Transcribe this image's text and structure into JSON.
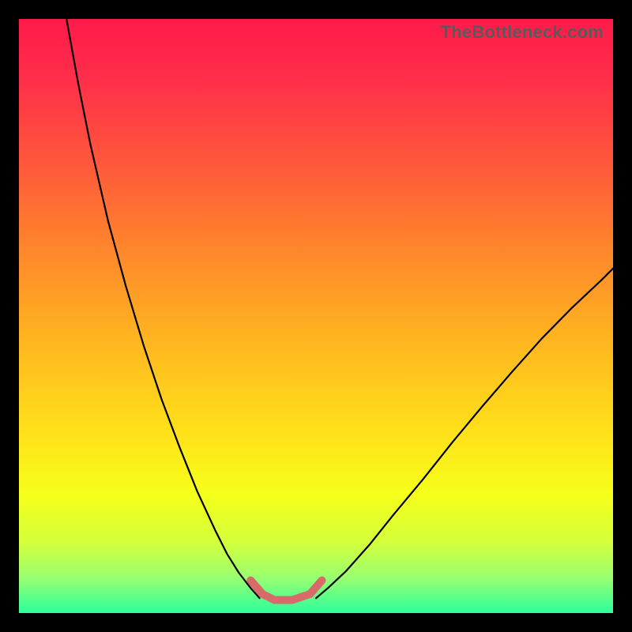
{
  "watermark": "TheBottleneck.com",
  "gradient_stops": [
    {
      "offset": 0.0,
      "color": "#ff1a4a"
    },
    {
      "offset": 0.1,
      "color": "#ff2e4a"
    },
    {
      "offset": 0.25,
      "color": "#ff5a3a"
    },
    {
      "offset": 0.4,
      "color": "#ff8a2a"
    },
    {
      "offset": 0.55,
      "color": "#ffb81f"
    },
    {
      "offset": 0.7,
      "color": "#ffe21a"
    },
    {
      "offset": 0.8,
      "color": "#f6ff1a"
    },
    {
      "offset": 0.88,
      "color": "#d4ff3a"
    },
    {
      "offset": 0.94,
      "color": "#9aff70"
    },
    {
      "offset": 1.0,
      "color": "#2cff9c"
    }
  ],
  "chart_data": {
    "type": "line",
    "title": "",
    "xlabel": "",
    "ylabel": "",
    "xlim": [
      0,
      100
    ],
    "ylim": [
      0,
      100
    ],
    "series": [
      {
        "name": "left-branch",
        "color": "#000000",
        "width": 2.2,
        "x": [
          8,
          10,
          12,
          15,
          18,
          21,
          24,
          27,
          30,
          33,
          35,
          37,
          39,
          40.5
        ],
        "y": [
          100,
          89,
          79,
          66,
          55,
          45,
          36,
          28,
          20.5,
          14,
          10,
          6.8,
          4.2,
          2.5
        ]
      },
      {
        "name": "right-branch",
        "color": "#000000",
        "width": 2.2,
        "x": [
          50,
          52,
          55,
          59,
          63,
          68,
          73,
          78,
          83,
          88,
          93,
          98,
          100
        ],
        "y": [
          2.5,
          4.2,
          7.0,
          11.5,
          16.5,
          22.5,
          28.8,
          34.8,
          40.6,
          46.2,
          51.3,
          56.0,
          58.0
        ]
      },
      {
        "name": "highlight-band",
        "color": "#d86a6a",
        "width": 10,
        "x": [
          39,
          41,
          43,
          46,
          49,
          51
        ],
        "y": [
          5.5,
          3.2,
          2.2,
          2.2,
          3.2,
          5.5
        ]
      }
    ]
  }
}
